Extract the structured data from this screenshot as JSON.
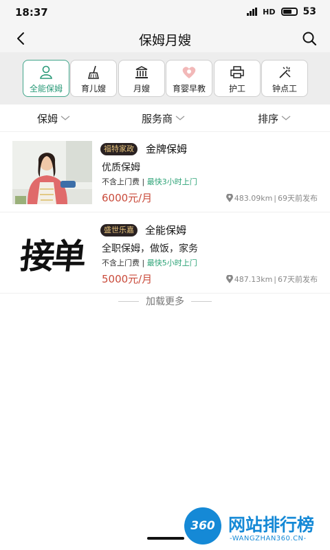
{
  "status_bar": {
    "time": "18:37",
    "battery": "53"
  },
  "header": {
    "title": "保姆月嫂"
  },
  "categories": [
    {
      "label": "全能保姆",
      "icon": "nanny-icon",
      "active": true
    },
    {
      "label": "育儿嫂",
      "icon": "broom-icon",
      "active": false
    },
    {
      "label": "月嫂",
      "icon": "building-icon",
      "active": false
    },
    {
      "label": "育婴早教",
      "icon": "heart-baby-icon",
      "active": false
    },
    {
      "label": "护工",
      "icon": "printer-icon",
      "active": false
    },
    {
      "label": "钟点工",
      "icon": "wand-icon",
      "active": false
    }
  ],
  "filters": [
    {
      "label": "保姆"
    },
    {
      "label": "服务商"
    },
    {
      "label": "排序"
    }
  ],
  "listings": [
    {
      "company": "福特家政",
      "title": "金牌保姆",
      "description": "优质保姆",
      "fee": "不含上门费",
      "separator": "|",
      "quick": "最快3小时上门",
      "price": "6000元/月",
      "distance": "483.09km",
      "posted": "69天前发布",
      "thumb_text": ""
    },
    {
      "company": "盛世乐嘉",
      "title": "全能保姆",
      "description": "全职保姆，做饭，家务",
      "fee": "不含上门费",
      "separator": "|",
      "quick": "最快5小时上门",
      "price": "5000元/月",
      "distance": "487.13km",
      "posted": "67天前发布",
      "thumb_text": "接单"
    }
  ],
  "load_more": "加载更多",
  "watermark": {
    "logo": "360",
    "title": "网站排行榜",
    "subtitle": "-WANGZHAN360.CN-"
  },
  "colors": {
    "accent": "#2a9a78",
    "price": "#c94a3a",
    "tag_bg": "#2a2222",
    "tag_text": "#e7c37c",
    "watermark": "#1589d6"
  }
}
